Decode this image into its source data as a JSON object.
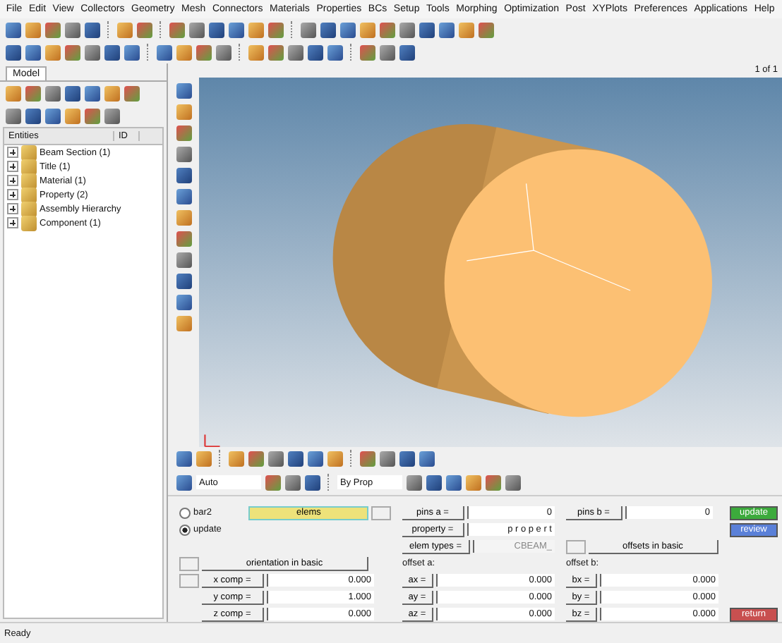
{
  "menu": [
    "File",
    "Edit",
    "View",
    "Collectors",
    "Geometry",
    "Mesh",
    "Connectors",
    "Materials",
    "Properties",
    "BCs",
    "Setup",
    "Tools",
    "Morphing",
    "Optimization",
    "Post",
    "XYPlots",
    "Preferences",
    "Applications",
    "Help"
  ],
  "page_indicator": "1 of 1",
  "browser": {
    "tab": "Model",
    "columns": [
      "Entities",
      "ID"
    ],
    "items": [
      {
        "label": "Beam Section (1)",
        "expanded": false
      },
      {
        "label": "Title (1)",
        "expanded": false
      },
      {
        "label": "Material (1)",
        "expanded": false
      },
      {
        "label": "Property (2)",
        "expanded": false
      },
      {
        "label": "Assembly Hierarchy",
        "expanded": false
      },
      {
        "label": "Component (1)",
        "expanded": false
      }
    ]
  },
  "display_toolbar": {
    "color_mode": "Auto",
    "color_by": "By Prop"
  },
  "panel": {
    "modes": [
      {
        "label": "bar2",
        "selected": false
      },
      {
        "label": "update",
        "selected": true
      }
    ],
    "elems": "elems",
    "pins_a": {
      "label": "pins a =",
      "value": "0"
    },
    "property": {
      "label": "property =",
      "value": "p r o p e r t"
    },
    "elem_types": {
      "label": "elem types =",
      "value": "CBEAM_",
      "disabled": true
    },
    "pins_b": {
      "label": "pins b =",
      "value": "0"
    },
    "offsets_basis": "offsets in basic",
    "orientation_basis": "orientation in basic",
    "orientation": [
      {
        "label": "x comp =",
        "value": "0.000"
      },
      {
        "label": "y comp =",
        "value": "1.000"
      },
      {
        "label": "z comp =",
        "value": "0.000"
      }
    ],
    "offset_a": {
      "title": "offset a:",
      "fields": [
        {
          "label": "ax =",
          "value": "0.000"
        },
        {
          "label": "ay =",
          "value": "0.000"
        },
        {
          "label": "az =",
          "value": "0.000"
        }
      ]
    },
    "offset_b": {
      "title": "offset b:",
      "fields": [
        {
          "label": "bx =",
          "value": "0.000"
        },
        {
          "label": "by =",
          "value": "0.000"
        },
        {
          "label": "bz =",
          "value": "0.000"
        }
      ]
    },
    "actions": [
      {
        "label": "update",
        "kind": "update"
      },
      {
        "label": "review",
        "kind": "review"
      },
      {
        "label": "return",
        "kind": "return"
      }
    ]
  },
  "status_bar": "Ready"
}
